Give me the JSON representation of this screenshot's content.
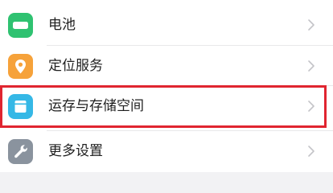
{
  "settings": {
    "items": [
      {
        "label": "电池",
        "icon": "battery-icon"
      },
      {
        "label": "定位服务",
        "icon": "location-pin-icon"
      },
      {
        "label": "运存与存储空间",
        "icon": "storage-icon"
      },
      {
        "label": "更多设置",
        "icon": "wrench-icon"
      }
    ]
  },
  "colors": {
    "battery_icon_bg": "#2fc271",
    "location_icon_bg": "#f6a23a",
    "storage_icon_bg": "#35b8e6",
    "more_icon_bg": "#8a939e",
    "highlight_border": "#e02530"
  }
}
